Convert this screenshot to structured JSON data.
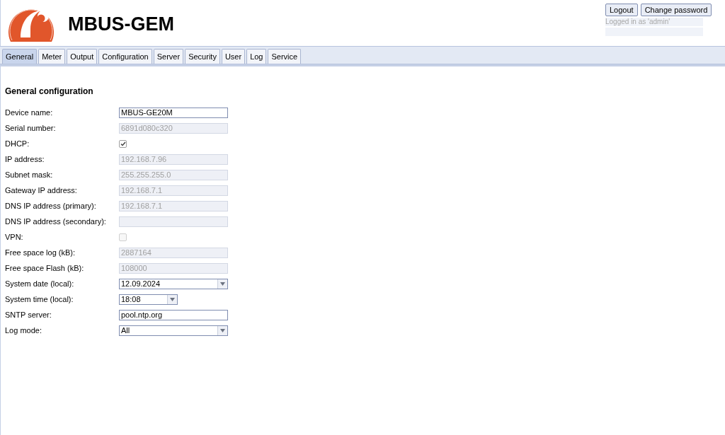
{
  "header": {
    "title": "MBUS-GEM",
    "buttons": [
      "Logout",
      "Change password"
    ],
    "login_status": "Logged in as 'admin'"
  },
  "tabs": [
    {
      "label": "General",
      "selected": true
    },
    {
      "label": "Meter",
      "selected": false
    },
    {
      "label": "Output",
      "selected": false
    },
    {
      "label": "Configuration",
      "selected": false
    },
    {
      "label": "Server",
      "selected": false
    },
    {
      "label": "Security",
      "selected": false
    },
    {
      "label": "User",
      "selected": false
    },
    {
      "label": "Log",
      "selected": false
    },
    {
      "label": "Service",
      "selected": false
    }
  ],
  "section": {
    "title": "General configuration"
  },
  "fields": [
    {
      "label": "Device name:",
      "kind": "text",
      "value": "MBUS-GE20M",
      "disabled": false
    },
    {
      "label": "Serial number:",
      "kind": "text",
      "value": "6891d080c320",
      "disabled": true
    },
    {
      "label": "DHCP:",
      "kind": "checkbox",
      "checked": true,
      "disabled": false
    },
    {
      "label": "IP address:",
      "kind": "text",
      "value": "192.168.7.96",
      "disabled": true
    },
    {
      "label": "Subnet mask:",
      "kind": "text",
      "value": "255.255.255.0",
      "disabled": true
    },
    {
      "label": "Gateway IP address:",
      "kind": "text",
      "value": "192.168.7.1",
      "disabled": true
    },
    {
      "label": "DNS IP address (primary):",
      "kind": "text",
      "value": "192.168.7.1",
      "disabled": true
    },
    {
      "label": "DNS IP address (secondary):",
      "kind": "text",
      "disabled": true
    },
    {
      "label": "VPN:",
      "kind": "checkbox",
      "checked": false,
      "disabled": true
    },
    {
      "label": "Free space log (kB):",
      "kind": "text",
      "value": "2887164",
      "disabled": true
    },
    {
      "label": "Free space Flash (kB):",
      "kind": "text",
      "value": "108000",
      "disabled": true
    },
    {
      "label": "System date (local):",
      "kind": "combo",
      "value": "12.09.2024"
    },
    {
      "label": "System time (local):",
      "kind": "short-combo",
      "value": "18:08"
    },
    {
      "label": "SNTP server:",
      "kind": "text",
      "value": "pool.ntp.org",
      "disabled": false
    },
    {
      "label": "Log mode:",
      "kind": "combo",
      "value": "All"
    }
  ]
}
